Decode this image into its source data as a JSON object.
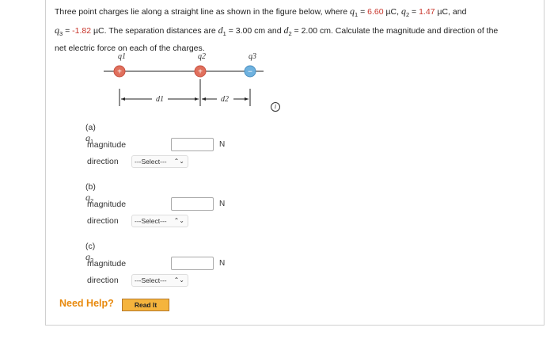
{
  "problem": {
    "p1": "Three point charges lie along a straight line as shown in the figure below, where",
    "q1_name": "q",
    "q1_sub": "1",
    "eq1": " = ",
    "q1_val": "6.60",
    "unit_uc": " µC, ",
    "q2_name": "q",
    "q2_sub": "2",
    "eq2": " = ",
    "q2_val": "1.47",
    "and": " µC, and",
    "q3_name": "q",
    "q3_sub": "3",
    "eq3": " = ",
    "q3_val": "-1.82",
    "p2": " µC. The separation distances are ",
    "d1_name": "d",
    "d1_sub": "1",
    "d1_text": " = 3.00 cm and ",
    "d2_name": "d",
    "d2_sub": "2",
    "d2_text": " = 2.00 cm. Calculate the magnitude and direction of the",
    "p3": "net electric force on each of the charges."
  },
  "figure": {
    "q1_label": "q1",
    "q2_label": "q2",
    "q3_label": "q3",
    "d1_label": "d1",
    "d2_label": "d2",
    "plus": "+",
    "minus": "−",
    "colors": {
      "positive": "#e0705d",
      "negative": "#6fb2df",
      "line": "#222222"
    }
  },
  "parts": [
    {
      "label": "(a)",
      "q": "q",
      "sub": "1",
      "magnitude_label": "magnitude",
      "unit": "N",
      "direction_label": "direction",
      "select_value": "---Select---"
    },
    {
      "label": "(b)",
      "q": "q",
      "sub": "2",
      "magnitude_label": "magnitude",
      "unit": "N",
      "direction_label": "direction",
      "select_value": "---Select---"
    },
    {
      "label": "(c)",
      "q": "q",
      "sub": "3",
      "magnitude_label": "magnitude",
      "unit": "N",
      "direction_label": "direction",
      "select_value": "---Select---"
    }
  ],
  "help": {
    "label": "Need Help?",
    "read_it": "Read It"
  },
  "info_icon_text": "i",
  "select_chevron": "⌃⌄"
}
